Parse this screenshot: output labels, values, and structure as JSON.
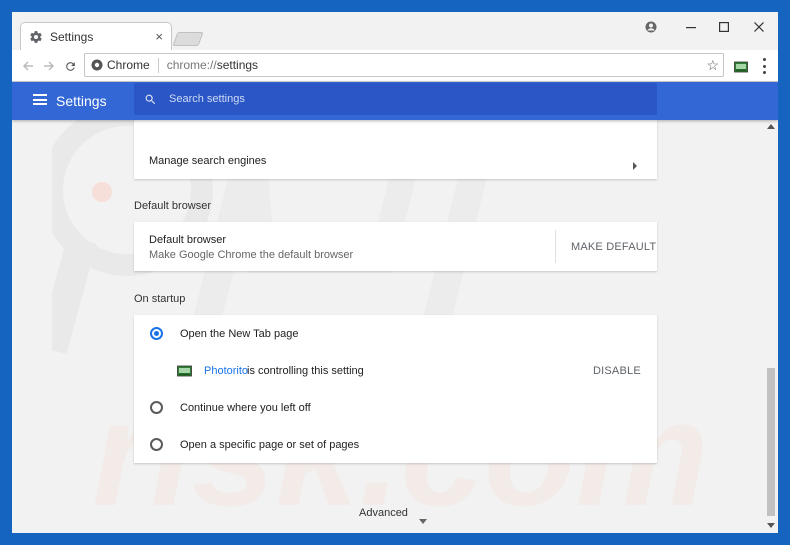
{
  "tab": {
    "title": "Settings",
    "close": "×"
  },
  "window_controls": {
    "minimize": "—",
    "maximize": "☐",
    "close": "✕"
  },
  "omnibox": {
    "site_label": "Chrome",
    "url_scheme": "chrome://",
    "url_path": "settings"
  },
  "appbar": {
    "title": "Settings",
    "search_placeholder": "Search settings"
  },
  "search_engine": {
    "manage_label": "Manage search engines"
  },
  "default_browser": {
    "section_label": "Default browser",
    "row_title": "Default browser",
    "row_subtitle": "Make Google Chrome the default browser",
    "button_label": "MAKE DEFAULT"
  },
  "startup": {
    "section_label": "On startup",
    "options": [
      {
        "label": "Open the New Tab page",
        "selected": true
      },
      {
        "label": "Continue where you left off",
        "selected": false
      },
      {
        "label": "Open a specific page or set of pages",
        "selected": false
      }
    ],
    "extension_name": "Photorito",
    "extension_text": "is controlling this setting",
    "disable_label": "DISABLE"
  },
  "advanced": {
    "label": "Advanced"
  },
  "colors": {
    "accent": "#3367d6",
    "search_bg": "#2a56c6",
    "link": "#1a73e8",
    "frame": "#1565c0"
  }
}
